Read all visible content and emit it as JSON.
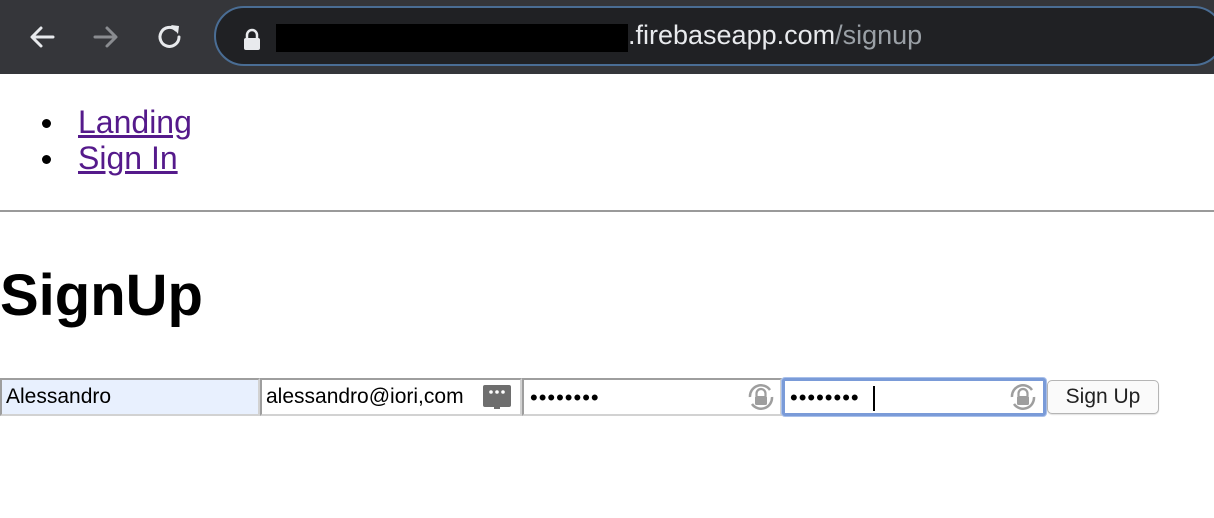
{
  "browser": {
    "url_host": ".firebaseapp.com",
    "url_path": "/signup",
    "icons": {
      "back": "arrow-left-icon",
      "forward": "arrow-right-icon",
      "reload": "reload-icon",
      "lock": "lock-icon"
    }
  },
  "nav": {
    "items": [
      {
        "label": "Landing"
      },
      {
        "label": "Sign In"
      }
    ]
  },
  "page": {
    "title": "SignUp"
  },
  "form": {
    "username": {
      "value": "Alessandro"
    },
    "email": {
      "value": "alessandro@iori,com"
    },
    "password": {
      "value": "••••••••"
    },
    "password_confirm": {
      "value": "••••••••"
    },
    "submit_label": "Sign Up"
  },
  "colors": {
    "toolbar": "#35363a",
    "omnibox": "#202124",
    "link_visited": "#551a8b",
    "autofill": "#e8f0fe",
    "focus_ring": "#7a9bd8"
  }
}
